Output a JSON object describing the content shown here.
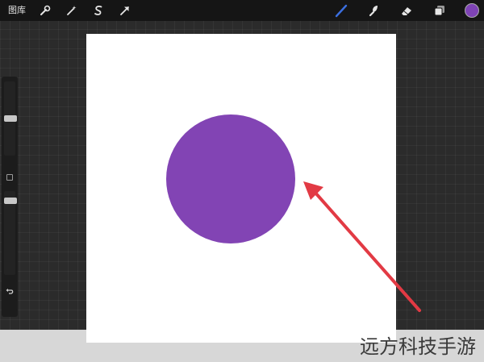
{
  "toolbar": {
    "gallery_label": "图库",
    "left_tools": [
      "actions-wrench-icon",
      "adjustments-wand-icon",
      "selection-s-icon",
      "transform-arrow-icon"
    ],
    "right_tools": [
      "brush-icon",
      "smudge-icon",
      "eraser-icon",
      "layers-icon"
    ],
    "active_tool": "brush-icon",
    "active_color": "#7e43b5",
    "brush_color": "#3b6fe0"
  },
  "sidebar": {
    "brush_size": 0.5,
    "opacity": 1.0,
    "undo_icon": "undo-icon"
  },
  "canvas": {
    "background_color": "#ffffff",
    "circle_color": "#8244b4",
    "arrow_color": "#e23a44"
  },
  "watermark": {
    "text": "远方科技手游"
  }
}
